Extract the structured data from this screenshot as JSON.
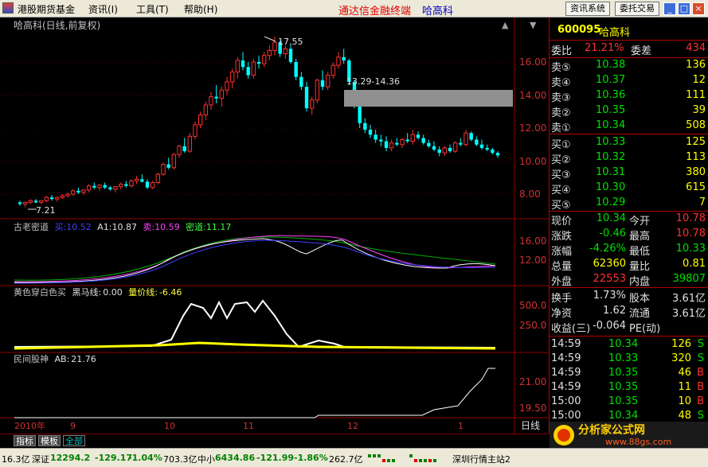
{
  "menubar": {
    "items": [
      "港股期货基金",
      "资讯(I)",
      "工具(T)",
      "帮助(H)"
    ],
    "app_name": "通达信金融终端",
    "stock_title": "哈高科",
    "btn_info": "资讯系统",
    "btn_trade": "委托交易"
  },
  "main": {
    "title": "哈高科(日线,前复权)",
    "high_label": "17.55",
    "low_label": "7.21",
    "range_label": "13.29-14.36",
    "price_ticks": [
      "16.00",
      "14.00",
      "12.00",
      "10.00",
      "8.00"
    ],
    "date_labels": [
      "2010年",
      "9",
      "10",
      "11",
      "12",
      "1"
    ],
    "period": "日线"
  },
  "ind1": {
    "name": "古老密道",
    "k1": "买:",
    "v1": "10.52",
    "k2": "A1:",
    "v2": "10.87",
    "k3": "卖:",
    "v3": "10.59",
    "k4": "密道:",
    "v4": "11.17",
    "ticks": [
      "16.00",
      "12.00"
    ]
  },
  "ind2": {
    "name": "黄色穿白色买",
    "k1": "黑马线:",
    "v1": "0.00",
    "k2": "量价线:",
    "v2": "-6.46",
    "ticks": [
      "500.0",
      "250.0"
    ]
  },
  "ind3": {
    "name": "民间股神",
    "k1": "AB:",
    "v1": "21.76",
    "ticks": [
      "21.00",
      "19.50"
    ]
  },
  "tabs": [
    "指标",
    "模板",
    "全部"
  ],
  "quote": {
    "code": "600095",
    "name": "哈高科",
    "wb_label": "委比",
    "wb": "21.21%",
    "wc_label": "委差",
    "wc": "434",
    "sell": [
      {
        "l": "卖⑤",
        "p": "10.38",
        "v": "136"
      },
      {
        "l": "卖④",
        "p": "10.37",
        "v": "12"
      },
      {
        "l": "卖③",
        "p": "10.36",
        "v": "111"
      },
      {
        "l": "卖②",
        "p": "10.35",
        "v": "39"
      },
      {
        "l": "卖①",
        "p": "10.34",
        "v": "508"
      }
    ],
    "buy": [
      {
        "l": "买①",
        "p": "10.33",
        "v": "125"
      },
      {
        "l": "买②",
        "p": "10.32",
        "v": "113"
      },
      {
        "l": "买③",
        "p": "10.31",
        "v": "380"
      },
      {
        "l": "买④",
        "p": "10.30",
        "v": "615"
      },
      {
        "l": "买⑤",
        "p": "10.29",
        "v": "7"
      }
    ],
    "stats": [
      {
        "a": "现价",
        "av": "10.34",
        "b": "今开",
        "bv": "10.78"
      },
      {
        "a": "涨跌",
        "av": "-0.46",
        "b": "最高",
        "bv": "10.78"
      },
      {
        "a": "涨幅",
        "av": "-4.26%",
        "b": "最低",
        "bv": "10.33"
      },
      {
        "a": "总量",
        "av": "62360",
        "b": "量比",
        "bv": "0.81"
      },
      {
        "a": "外盘",
        "av": "22553",
        "b": "内盘",
        "bv": "39807"
      }
    ],
    "stats2": [
      {
        "a": "换手",
        "av": "1.73%",
        "b": "股本",
        "bv": "3.61亿"
      },
      {
        "a": "净资",
        "av": "1.62",
        "b": "流通",
        "bv": "3.61亿"
      },
      {
        "a": "收益(三)",
        "av": "-0.064",
        "b": "PE(动)",
        "bv": ""
      }
    ],
    "ticks": [
      {
        "t": "14:59",
        "p": "10.34",
        "v": "126",
        "s": "S"
      },
      {
        "t": "14:59",
        "p": "10.33",
        "v": "320",
        "s": "S"
      },
      {
        "t": "14:59",
        "p": "10.35",
        "v": "46",
        "s": "B"
      },
      {
        "t": "14:59",
        "p": "10.35",
        "v": "11",
        "s": "B"
      },
      {
        "t": "15:00",
        "p": "10.35",
        "v": "10",
        "s": "B"
      },
      {
        "t": "15:00",
        "p": "10.34",
        "v": "48",
        "s": "S"
      }
    ]
  },
  "status": {
    "s0": "16.3亿",
    "sz_label": "深证",
    "sz": "12294.2",
    "sz_chg": "-129.17",
    "sz_pct": "-1.04%",
    "sz_amt": "703.3亿",
    "zx_label": "中小",
    "zx": "6434.86",
    "zx_chg": "-121.99",
    "zx_pct": "-1.86%",
    "zx_amt": "262.7亿",
    "server": "深圳行情主站2"
  },
  "watermark": {
    "name": "分析家公式网",
    "url": "www.88gs.com"
  },
  "chart_data": {
    "type": "candlestick",
    "ylim": [
      7,
      18
    ],
    "candles": [
      [
        7.5,
        7.6,
        7.3,
        7.4
      ],
      [
        7.4,
        7.55,
        7.2,
        7.5
      ],
      [
        7.5,
        7.7,
        7.4,
        7.6
      ],
      [
        7.6,
        7.7,
        7.45,
        7.5
      ],
      [
        7.5,
        7.65,
        7.4,
        7.6
      ],
      [
        7.6,
        7.9,
        7.5,
        7.8
      ],
      [
        7.8,
        7.95,
        7.6,
        7.7
      ],
      [
        7.7,
        7.85,
        7.55,
        7.8
      ],
      [
        7.8,
        8.0,
        7.7,
        7.9
      ],
      [
        7.9,
        8.1,
        7.8,
        8.0
      ],
      [
        8.0,
        8.3,
        7.9,
        8.2
      ],
      [
        8.2,
        8.4,
        8.0,
        8.1
      ],
      [
        8.1,
        8.3,
        7.95,
        8.25
      ],
      [
        8.25,
        8.6,
        8.1,
        8.5
      ],
      [
        8.5,
        8.7,
        8.3,
        8.4
      ],
      [
        8.4,
        8.6,
        8.2,
        8.55
      ],
      [
        8.55,
        8.7,
        8.3,
        8.4
      ],
      [
        8.4,
        8.5,
        8.2,
        8.3
      ],
      [
        8.3,
        8.5,
        8.1,
        8.45
      ],
      [
        8.45,
        8.7,
        8.3,
        8.6
      ],
      [
        8.6,
        8.8,
        8.4,
        8.5
      ],
      [
        8.5,
        8.9,
        8.4,
        8.8
      ],
      [
        8.8,
        9.1,
        8.6,
        8.9
      ],
      [
        8.9,
        9.2,
        8.7,
        8.75
      ],
      [
        8.75,
        8.9,
        8.3,
        8.4
      ],
      [
        8.4,
        8.8,
        8.3,
        8.7
      ],
      [
        8.7,
        9.3,
        8.6,
        9.2
      ],
      [
        9.2,
        9.9,
        9.1,
        9.8
      ],
      [
        9.8,
        10.2,
        9.5,
        9.6
      ],
      [
        9.6,
        10.5,
        9.5,
        10.4
      ],
      [
        10.4,
        11.0,
        10.2,
        10.9
      ],
      [
        10.9,
        11.4,
        10.5,
        10.6
      ],
      [
        10.6,
        11.7,
        10.5,
        11.5
      ],
      [
        11.5,
        12.4,
        11.3,
        12.2
      ],
      [
        12.2,
        13.0,
        12.0,
        12.8
      ],
      [
        12.8,
        13.6,
        12.5,
        13.4
      ],
      [
        13.4,
        14.2,
        13.1,
        13.9
      ],
      [
        13.9,
        14.6,
        13.5,
        13.8
      ],
      [
        13.8,
        14.5,
        13.3,
        14.3
      ],
      [
        14.3,
        15.1,
        14.0,
        14.8
      ],
      [
        14.8,
        15.6,
        14.4,
        15.4
      ],
      [
        15.4,
        16.3,
        15.0,
        16.1
      ],
      [
        16.1,
        16.6,
        15.5,
        15.7
      ],
      [
        15.7,
        16.0,
        15.0,
        15.2
      ],
      [
        15.2,
        16.2,
        15.0,
        16.0
      ],
      [
        16.0,
        16.4,
        15.6,
        15.9
      ],
      [
        15.9,
        16.6,
        15.7,
        16.4
      ],
      [
        16.4,
        17.0,
        16.1,
        16.7
      ],
      [
        16.7,
        17.55,
        16.4,
        17.2
      ],
      [
        17.2,
        17.3,
        16.3,
        16.5
      ],
      [
        16.5,
        17.0,
        16.2,
        16.8
      ],
      [
        16.8,
        17.1,
        15.9,
        16.0
      ],
      [
        16.0,
        16.2,
        14.9,
        15.1
      ],
      [
        15.1,
        15.4,
        14.3,
        14.5
      ],
      [
        14.5,
        14.8,
        13.0,
        13.2
      ],
      [
        13.2,
        13.9,
        12.8,
        13.7
      ],
      [
        13.7,
        15.0,
        13.5,
        14.9
      ],
      [
        14.9,
        15.5,
        14.3,
        14.5
      ],
      [
        14.5,
        15.4,
        14.3,
        15.2
      ],
      [
        15.2,
        16.0,
        15.0,
        15.8
      ],
      [
        15.8,
        16.6,
        15.6,
        16.3
      ],
      [
        16.3,
        16.8,
        15.9,
        16.1
      ],
      [
        16.1,
        16.2,
        14.6,
        14.8
      ],
      [
        14.8,
        14.9,
        13.2,
        13.4
      ],
      [
        13.4,
        13.5,
        12.0,
        12.3
      ],
      [
        12.3,
        12.6,
        11.7,
        11.9
      ],
      [
        11.9,
        12.2,
        11.4,
        11.6
      ],
      [
        11.6,
        11.9,
        11.1,
        11.3
      ],
      [
        11.3,
        11.6,
        10.9,
        11.2
      ],
      [
        11.2,
        11.5,
        10.6,
        10.8
      ],
      [
        10.8,
        11.3,
        10.6,
        11.1
      ],
      [
        11.1,
        11.4,
        10.9,
        11.0
      ],
      [
        11.0,
        11.4,
        10.8,
        11.3
      ],
      [
        11.3,
        11.7,
        11.1,
        11.2
      ],
      [
        11.2,
        11.9,
        11.0,
        11.6
      ],
      [
        11.6,
        11.8,
        11.3,
        11.4
      ],
      [
        11.4,
        11.6,
        11.0,
        11.1
      ],
      [
        11.1,
        11.3,
        10.8,
        10.9
      ],
      [
        10.9,
        11.2,
        10.6,
        10.7
      ],
      [
        10.7,
        10.9,
        10.3,
        10.5
      ],
      [
        10.5,
        10.9,
        10.3,
        10.8
      ],
      [
        10.8,
        11.0,
        10.5,
        10.6
      ],
      [
        10.6,
        11.2,
        10.5,
        11.1
      ],
      [
        11.1,
        11.4,
        10.9,
        11.0
      ],
      [
        11.0,
        11.9,
        10.9,
        11.7
      ],
      [
        11.7,
        11.8,
        11.2,
        11.3
      ],
      [
        11.3,
        11.5,
        10.9,
        11.0
      ],
      [
        11.0,
        11.3,
        10.7,
        10.8
      ],
      [
        10.8,
        11.0,
        10.6,
        10.7
      ],
      [
        10.7,
        10.8,
        10.4,
        10.5
      ],
      [
        10.5,
        10.6,
        10.2,
        10.34
      ]
    ]
  }
}
